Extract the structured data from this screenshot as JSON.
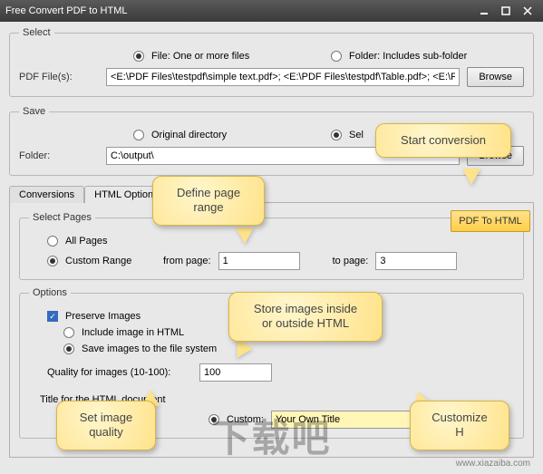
{
  "window": {
    "title": "Free Convert PDF to HTML"
  },
  "select": {
    "legend": "Select",
    "file_radio": "File:  One or more files",
    "folder_radio": "Folder: Includes sub-folder",
    "pdf_label": "PDF File(s):",
    "pdf_value": "<E:\\PDF Files\\testpdf\\simple text.pdf>; <E:\\PDF Files\\testpdf\\Table.pdf>; <E:\\PDF",
    "browse": "Browse"
  },
  "save": {
    "legend": "Save",
    "orig_radio": "Original directory",
    "sel_radio": "Sel",
    "folder_label": "Folder:",
    "folder_value": "C:\\output\\",
    "browse": "Browse"
  },
  "tabs": {
    "conversions": "Conversions",
    "html_options": "HTML Options"
  },
  "pages": {
    "legend": "Select Pages",
    "all": "All Pages",
    "custom": "Custom Range",
    "from_label": "from page:",
    "from_value": "1",
    "to_label": "to page:",
    "to_value": "3"
  },
  "options": {
    "legend": "Options",
    "preserve": "Preserve Images",
    "include": "Include image in HTML",
    "savefs": "Save images to the file system",
    "quality_label": "Quality for images (10-100):",
    "quality_value": "100",
    "title_label": "Title for the HTML document",
    "custom_radio": "Custom:",
    "custom_value": "Your Own Title"
  },
  "action": {
    "button": "PDF To HTML"
  },
  "callouts": {
    "start": "Start conversion",
    "range": "Define page\nrange",
    "store": "Store images inside\nor outside HTML",
    "quality": "Set image\nquality",
    "custom": "Customize\nH"
  },
  "watermark": {
    "text": "下载吧",
    "url": "www.xiazaiba.com"
  }
}
